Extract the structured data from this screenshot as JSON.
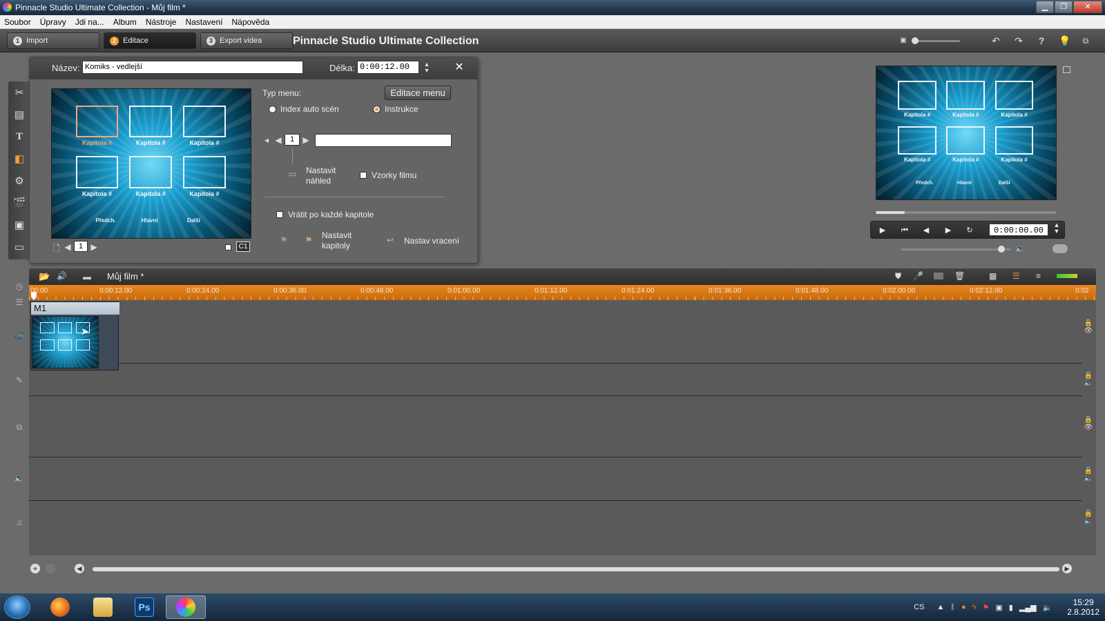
{
  "window": {
    "title": "Pinnacle Studio Ultimate Collection - Můj film *"
  },
  "menubar": [
    "Soubor",
    "Úpravy",
    "Jdi na...",
    "Album",
    "Nástroje",
    "Nastavení",
    "Nápověda"
  ],
  "steps": [
    {
      "num": "1",
      "label": "Import",
      "active": false
    },
    {
      "num": "2",
      "label": "Editace",
      "active": true
    },
    {
      "num": "3",
      "label": "Export videa",
      "active": false
    }
  ],
  "app": {
    "title": "Pinnacle Studio Ultimate Collection"
  },
  "editor": {
    "name_label": "Název:",
    "name_value": "Komiks - vedlejší",
    "length_label": "Délka:",
    "length_value": "0:00:12.00",
    "close_icon": "close-icon",
    "menu_type_label": "Typ menu:",
    "edit_menu_button": "Editace menu",
    "radio_index": "Index auto scén",
    "radio_instructions": "Instrukce",
    "radio_selected": "Instrukce",
    "page_counter": "1",
    "chapter_counter": "1",
    "chapter_title_value": "",
    "set_preview_label": "Nastavit náhled",
    "film_samples_label": "Vzorky filmu",
    "return_label": "Vrátit po každé kapitole",
    "set_chapters_label": "Nastavit kapitoly",
    "set_return_label": "Nastav vracení",
    "chapter_badge": "C1"
  },
  "menu_preview": {
    "chapters": [
      "Kapitola #",
      "Kapitola #",
      "Kapitola #",
      "Kapitola #",
      "Kapitola #",
      "Kapitola #"
    ],
    "nav": [
      "Předch.",
      "Hlavní",
      "Další"
    ]
  },
  "player": {
    "timecode": "0:00:00.00",
    "scrub_position": 0.16,
    "volume": 0.94
  },
  "timeline": {
    "project_title": "Můj film *",
    "ruler": [
      "00:00",
      "0:00:12.00",
      "0:00:24.00",
      "0:00:36.00",
      "0:00:48.00",
      "0:01:00.00",
      "0:01:12.00",
      "0:01:24.00",
      "0:01:36.00",
      "0:01:48.00",
      "0:02:00.00",
      "0:02:12.00",
      "0:02"
    ],
    "clip_label": "M1"
  },
  "taskbar": {
    "language": "CS",
    "time": "15:29",
    "date": "2.8.2012"
  },
  "colors": {
    "accent": "#e59a2c",
    "ruler": "#d97714",
    "panel": "#656565",
    "track": "#5a5a5a"
  }
}
